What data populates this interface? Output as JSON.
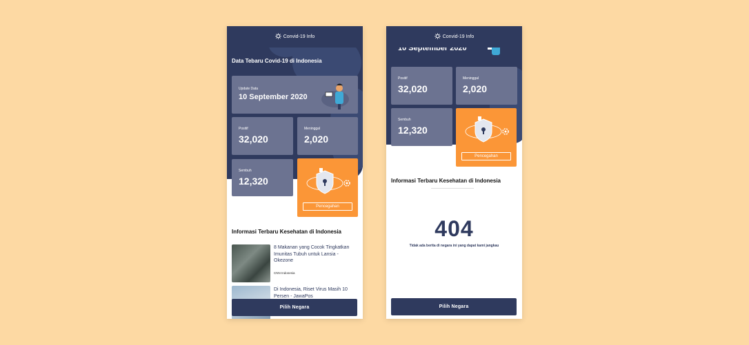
{
  "app": {
    "title": "Convid-19 Info"
  },
  "hero": {
    "title": "Data Tebaru Covid-19 di Indonesia"
  },
  "update": {
    "label": "Update Data",
    "date": "10 September 2020"
  },
  "stats": {
    "positif": {
      "label": "Positif",
      "value": "32,020"
    },
    "meninggal": {
      "label": "Meninggal",
      "value": "2,020"
    },
    "sembuh": {
      "label": "Sembuh",
      "value": "12,320"
    }
  },
  "prevention": {
    "button": "Pencegahan"
  },
  "news": {
    "section_title": "Informasi Terbaru Kesehatan di Indonesia",
    "items": [
      {
        "title": "8 Makanan yang Cocok Tingkatkan Imunitas Tubuh untuk Lansia - Okezone",
        "source": "CNN Indonesia"
      },
      {
        "title": "Di Indonesia, Riset Virus Masih 10 Persen - JawaPos",
        "source": ""
      }
    ]
  },
  "error": {
    "code": "404",
    "message": "Tidak ada berita di negara ini yang dapat kami jangkau"
  },
  "footer": {
    "button": "Pilih Negara"
  },
  "colors": {
    "navy": "#2F3A5E",
    "card": "#6C7391",
    "orange": "#FB9637",
    "background": "#FDD9A3"
  }
}
